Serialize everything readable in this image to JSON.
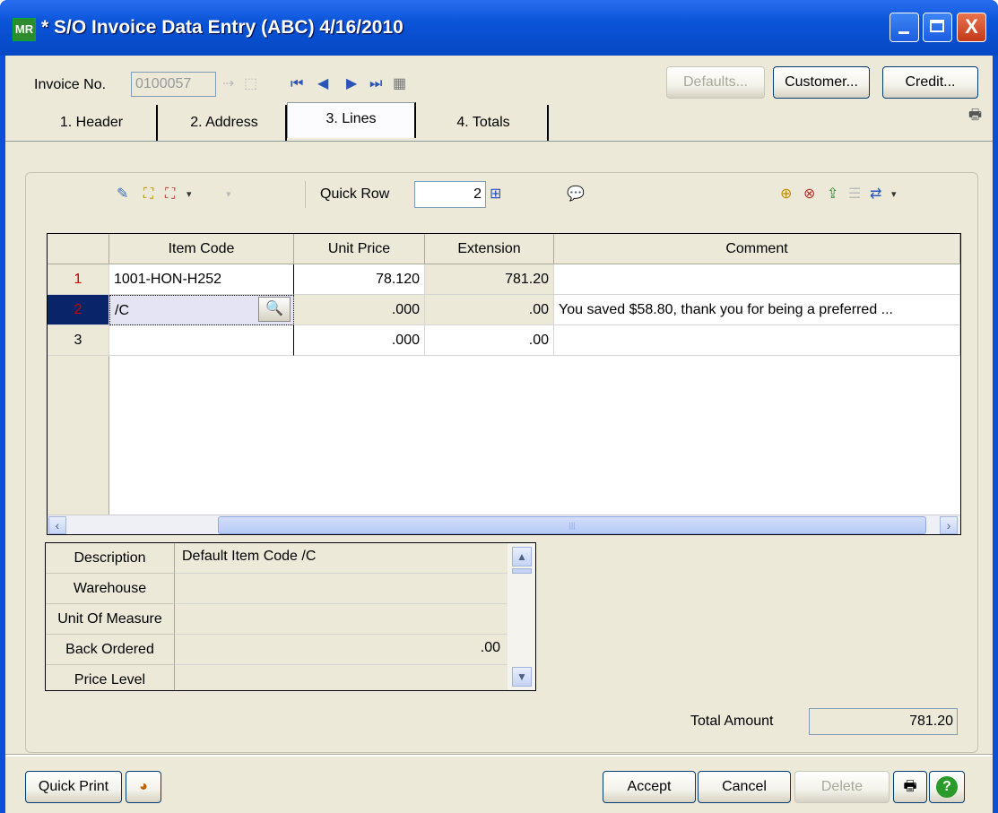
{
  "window": {
    "title": "* S/O Invoice Data Entry (ABC) 4/16/2010",
    "app_icon": "MR",
    "close_glyph": "X"
  },
  "header": {
    "invoice_label": "Invoice No.",
    "invoice_value": "0100057",
    "defaults_label": "Defaults...",
    "customer_label": "Customer...",
    "credit_label": "Credit..."
  },
  "tabs": [
    {
      "label": "1. Header"
    },
    {
      "label": "2. Address"
    },
    {
      "label": "3. Lines"
    },
    {
      "label": "4. Totals"
    }
  ],
  "toolbar": {
    "quick_row_label": "Quick Row",
    "quick_row_value": "2"
  },
  "grid": {
    "columns": [
      "Item Code",
      "Unit Price",
      "Extension",
      "Comment"
    ],
    "rows": [
      {
        "no": "1",
        "item_code": "1001-HON-H252",
        "unit_price": "78.120",
        "extension": "781.20",
        "comment": ""
      },
      {
        "no": "2",
        "item_code": "/C",
        "unit_price": ".000",
        "extension": ".00",
        "comment": "You saved $58.80, thank you for being a preferred ..."
      },
      {
        "no": "3",
        "item_code": "",
        "unit_price": ".000",
        "extension": ".00",
        "comment": ""
      }
    ]
  },
  "details": {
    "rows": [
      {
        "label": "Description",
        "value": "Default Item Code /C"
      },
      {
        "label": "Warehouse",
        "value": ""
      },
      {
        "label": "Unit Of Measure",
        "value": ""
      },
      {
        "label": "Back Ordered",
        "value": ".00"
      },
      {
        "label": "Price Level",
        "value": ""
      }
    ]
  },
  "totals": {
    "label": "Total Amount",
    "value": "781.20"
  },
  "footer": {
    "quick_print": "Quick Print",
    "accept": "Accept",
    "cancel": "Cancel",
    "delete": "Delete"
  },
  "colors": {
    "titlebar": "#0a54d8",
    "face": "#ece9d8",
    "selected_row": "#0a246a",
    "row_number_red": "#cc0000"
  }
}
